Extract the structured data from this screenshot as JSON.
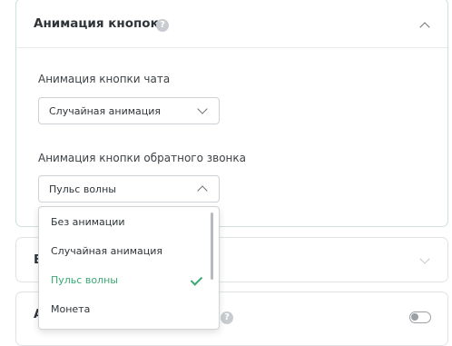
{
  "panel_main": {
    "title": "Анимация кнопок",
    "help": "?",
    "chat_field": {
      "label": "Анимация кнопки чата",
      "value": "Случайная анимация"
    },
    "callback_field": {
      "label": "Анимация кнопки обратного звонка",
      "value": "Пульс волны"
    }
  },
  "panel_2": {
    "title_fragment": "В"
  },
  "panel_3": {
    "title_fragment": "А",
    "help": "?"
  },
  "dropdown": {
    "options": [
      {
        "label": "Без анимации",
        "selected": false
      },
      {
        "label": "Случайная анимация",
        "selected": false
      },
      {
        "label": "Пульс волны",
        "selected": true
      },
      {
        "label": "Монета",
        "selected": false
      }
    ]
  },
  "colors": {
    "accent": "#3aa873",
    "border": "#dfe3e6",
    "text": "#2f3438"
  }
}
